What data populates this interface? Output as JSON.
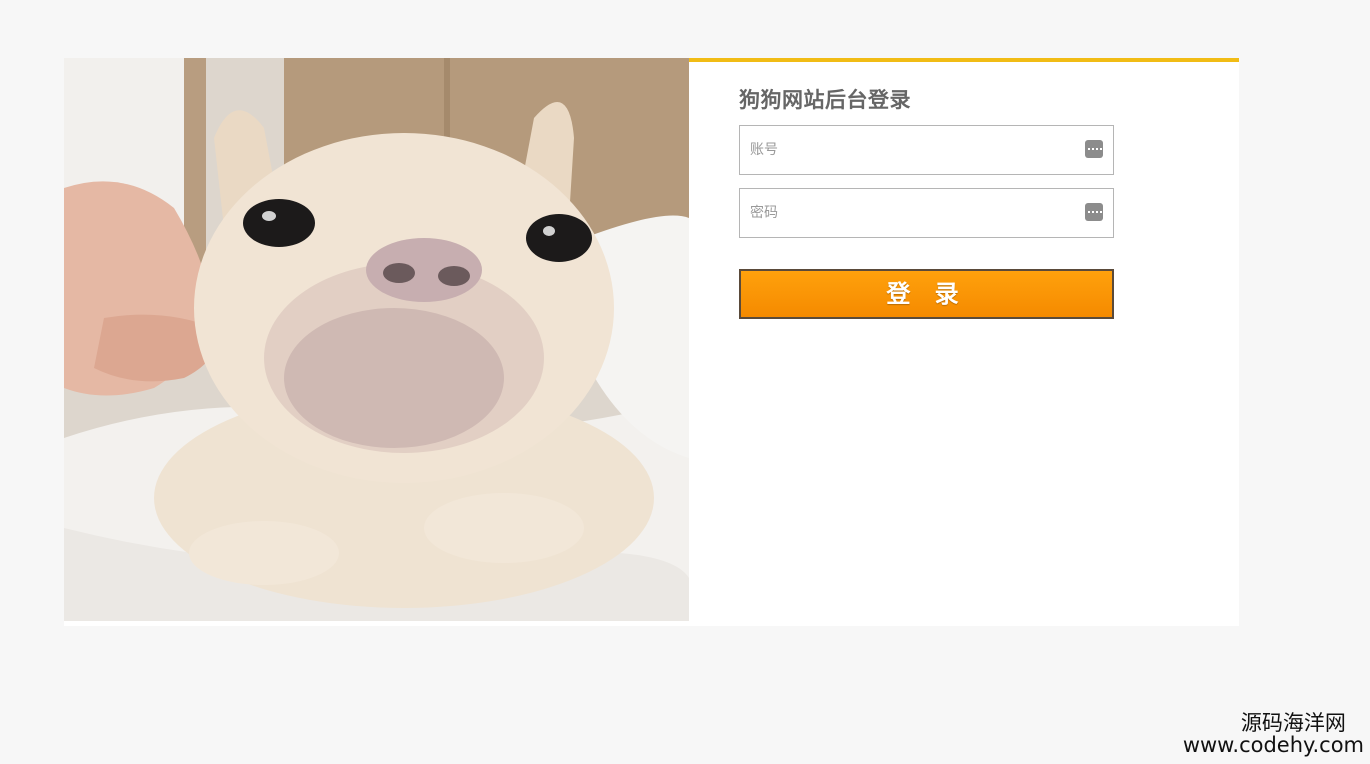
{
  "login": {
    "title": "狗狗网站后台登录",
    "username_placeholder": "账号",
    "password_placeholder": "密码",
    "submit_label": "登 录"
  },
  "watermark": {
    "name": "源码海洋网",
    "url": "www.codehy.com"
  },
  "colors": {
    "accent_top_border": "#f1bc15",
    "button": "#ff9900",
    "background": "#f7f7f7"
  },
  "photo": {
    "subject": "french-bulldog-photo"
  }
}
